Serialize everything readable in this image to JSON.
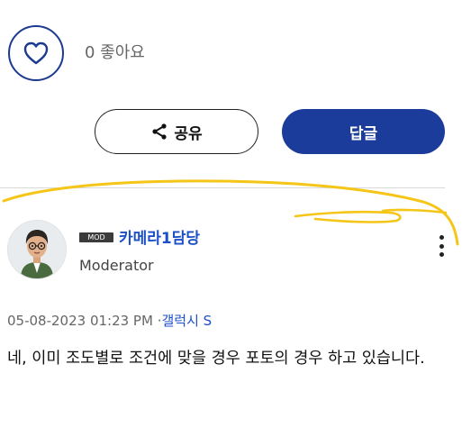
{
  "like": {
    "count_text": "0 좋아요"
  },
  "actions": {
    "share_label": "공유",
    "reply_label": "답글"
  },
  "post": {
    "badge": "MOD",
    "username": "카메라1담당",
    "role": "Moderator",
    "date": "05-08-2023 01:23 PM",
    "separator": "·",
    "category": "갤럭시 S",
    "body": "네, 이미 조도별로 조건에 맞을 경우 포토의 경우 하고 있습니다."
  },
  "colors": {
    "brand_blue": "#1c3c9b",
    "link_blue": "#1d50c8",
    "annotation_yellow": "#f5c518"
  },
  "icons": {
    "like": "heart-icon",
    "share": "share-icon",
    "menu": "more-vertical-icon"
  }
}
